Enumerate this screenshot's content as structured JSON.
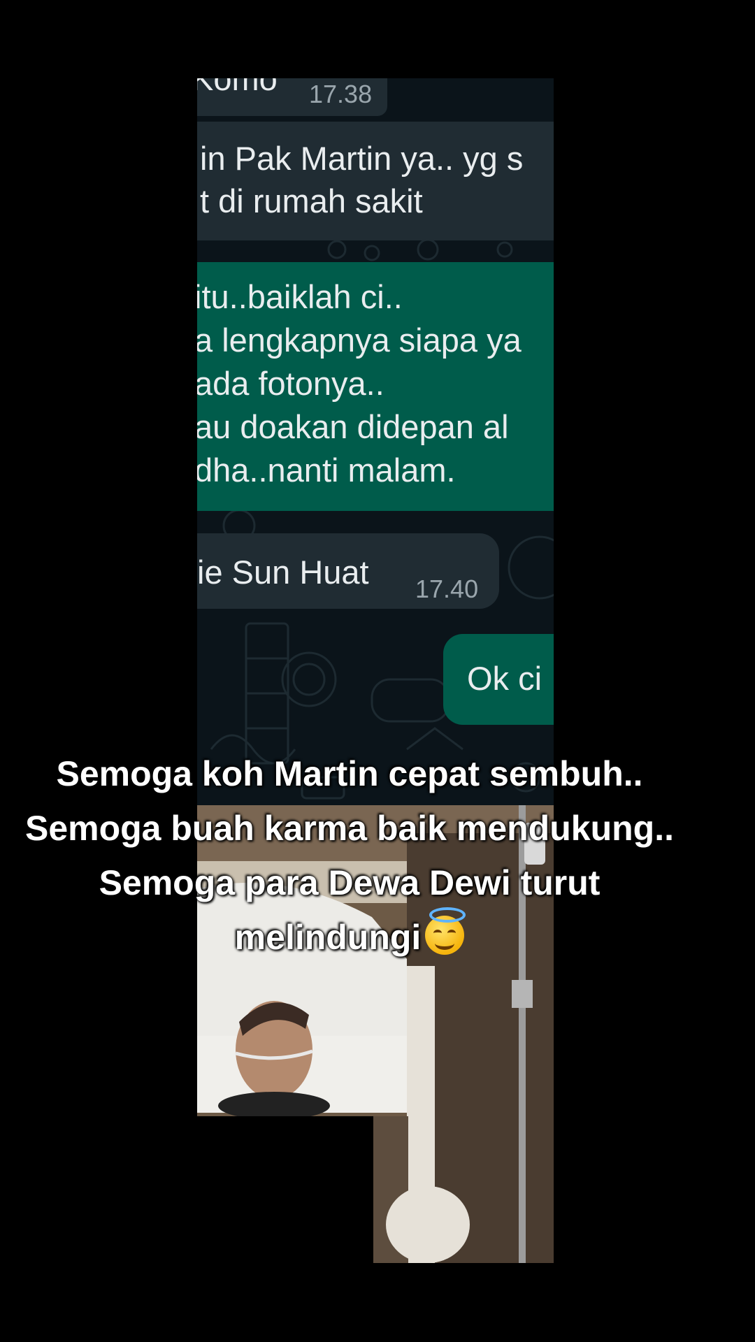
{
  "chat": {
    "messages": [
      {
        "id": "m1",
        "side": "incoming",
        "text": "Komo",
        "time": "17.38"
      },
      {
        "id": "m2",
        "side": "incoming",
        "lines": [
          "in Pak Martin ya.. yg s",
          "t di rumah sakit"
        ]
      },
      {
        "id": "m3",
        "side": "outgoing",
        "lines": [
          "itu..baiklah ci..",
          "a lengkapnya siapa ya",
          "ada fotonya..",
          "au doakan didepan al",
          "dha..nanti malam."
        ]
      },
      {
        "id": "m4",
        "side": "incoming",
        "text": "ie Sun Huat",
        "time": "17.40"
      },
      {
        "id": "m5",
        "side": "outgoing",
        "text": "Ok ci"
      }
    ]
  },
  "caption": {
    "lines": [
      "Semoga koh Martin cepat sembuh..",
      "Semoga buah karma baik mendukung..",
      "Semoga para Dewa Dewi turut",
      "melindungi"
    ],
    "emoji": "smiling-face-with-halo-icon"
  },
  "colors": {
    "background": "#000000",
    "chat_background": "#0b141a",
    "incoming_bubble": "#202c33",
    "outgoing_bubble": "#005c4b",
    "message_text": "#e9edef",
    "timestamp": "#9aa6ad"
  }
}
